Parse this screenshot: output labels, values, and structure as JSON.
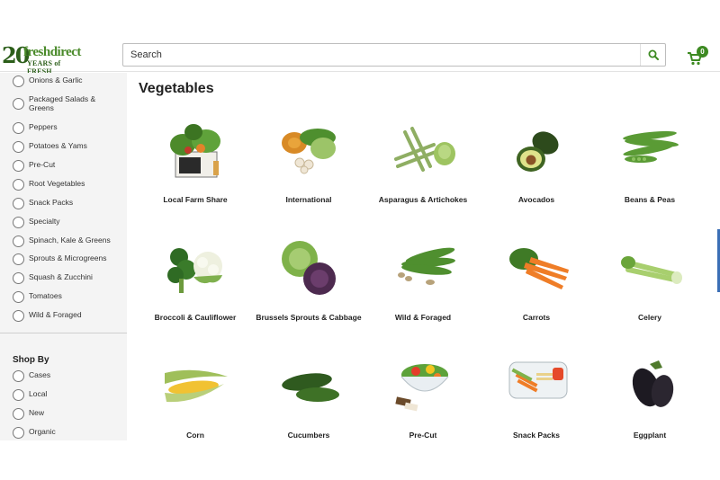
{
  "header": {
    "logo": {
      "number": "20",
      "brand": "freshdirect",
      "tagline": "YEARS of FRESH"
    },
    "search": {
      "placeholder": "Search"
    },
    "cart": {
      "count": "0"
    }
  },
  "sidebar": {
    "filters": [
      "Onions & Garlic",
      "Packaged Salads & Greens",
      "Peppers",
      "Potatoes & Yams",
      "Pre-Cut",
      "Root Vegetables",
      "Snack Packs",
      "Specialty",
      "Spinach, Kale & Greens",
      "Sprouts & Microgreens",
      "Squash & Zucchini",
      "Tomatoes",
      "Wild & Foraged"
    ],
    "shop_by": {
      "title": "Shop By",
      "options": [
        "Cases",
        "Local",
        "New",
        "Organic"
      ]
    }
  },
  "main": {
    "title": "Vegetables",
    "categories": [
      {
        "label": "Local Farm Share",
        "icon": "farm-share-box-icon"
      },
      {
        "label": "International",
        "icon": "international-vegetables-icon"
      },
      {
        "label": "Asparagus & Artichokes",
        "icon": "asparagus-icon"
      },
      {
        "label": "Avocados",
        "icon": "avocado-icon"
      },
      {
        "label": "Beans & Peas",
        "icon": "pea-pods-icon"
      },
      {
        "label": "Broccoli & Cauliflower",
        "icon": "broccoli-icon"
      },
      {
        "label": "Brussels Sprouts & Cabbage",
        "icon": "cabbage-icon"
      },
      {
        "label": "Wild & Foraged",
        "icon": "ramps-icon"
      },
      {
        "label": "Carrots",
        "icon": "carrots-icon"
      },
      {
        "label": "Celery",
        "icon": "celery-icon"
      },
      {
        "label": "Corn",
        "icon": "corn-icon"
      },
      {
        "label": "Cucumbers",
        "icon": "cucumber-icon"
      },
      {
        "label": "Pre-Cut",
        "icon": "salad-bowl-icon"
      },
      {
        "label": "Snack Packs",
        "icon": "snack-pack-icon"
      },
      {
        "label": "Eggplant",
        "icon": "eggplant-icon"
      }
    ]
  },
  "colors": {
    "brand_green": "#3d8a22",
    "sidebar_bg": "#f4f4f4"
  }
}
